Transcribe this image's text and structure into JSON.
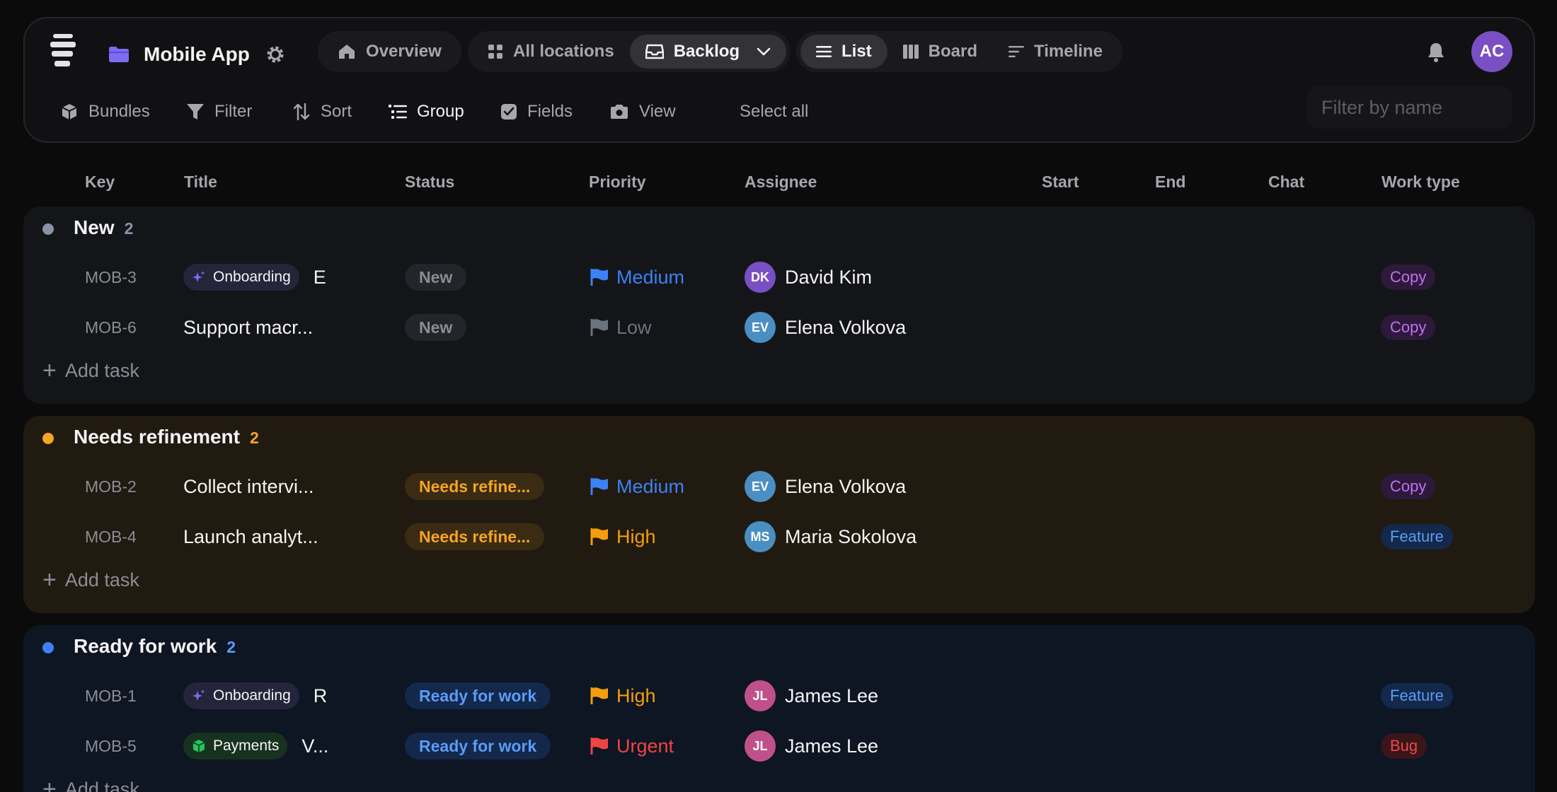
{
  "project": {
    "name": "Mobile App",
    "avatar_initials": "AC",
    "accent": "#7b4fc4"
  },
  "nav": {
    "overview": "Overview",
    "all_locations": "All locations",
    "backlog": "Backlog",
    "list": "List",
    "board": "Board",
    "timeline": "Timeline"
  },
  "toolbar": {
    "bundles": "Bundles",
    "filter": "Filter",
    "sort": "Sort",
    "group": "Group",
    "fields": "Fields",
    "view": "View",
    "select_all": "Select all",
    "filter_placeholder": "Filter by name"
  },
  "columns": {
    "key": "Key",
    "title": "Title",
    "status": "Status",
    "priority": "Priority",
    "assignee": "Assignee",
    "start": "Start",
    "end": "End",
    "chat": "Chat",
    "work_type": "Work type"
  },
  "add_task": "Add task",
  "groups": [
    {
      "name": "New",
      "count": "2",
      "color": "#8a93a6",
      "rows": [
        {
          "key": "MOB-3",
          "tag": "Onboarding",
          "title": "E",
          "status": "New",
          "priority": "Medium",
          "assignee_initials": "DK",
          "assignee": "David Kim",
          "work_type": "Copy"
        },
        {
          "key": "MOB-6",
          "tag": "",
          "title": "Support macr...",
          "status": "New",
          "priority": "Low",
          "assignee_initials": "EV",
          "assignee": "Elena Volkova",
          "work_type": "Copy"
        }
      ]
    },
    {
      "name": "Needs refinement",
      "count": "2",
      "color": "#f5a524",
      "rows": [
        {
          "key": "MOB-2",
          "tag": "",
          "title": "Collect intervi...",
          "status": "Needs refine...",
          "priority": "Medium",
          "assignee_initials": "EV",
          "assignee": "Elena Volkova",
          "work_type": "Copy"
        },
        {
          "key": "MOB-4",
          "tag": "",
          "title": "Launch analyt...",
          "status": "Needs refine...",
          "priority": "High",
          "assignee_initials": "MS",
          "assignee": "Maria Sokolova",
          "work_type": "Feature"
        }
      ]
    },
    {
      "name": "Ready for work",
      "count": "2",
      "color": "#3b82f6",
      "rows": [
        {
          "key": "MOB-1",
          "tag": "Onboarding",
          "title": "R",
          "status": "Ready for work",
          "priority": "High",
          "assignee_initials": "JL",
          "assignee": "James Lee",
          "work_type": "Feature"
        },
        {
          "key": "MOB-5",
          "tag": "Payments",
          "title": "V...",
          "status": "Ready for work",
          "priority": "Urgent",
          "assignee_initials": "JL",
          "assignee": "James Lee",
          "work_type": "Bug"
        }
      ]
    }
  ],
  "colors": {
    "priority_medium": "#3b82f6",
    "priority_low": "#6b7280",
    "priority_high": "#f59e0b",
    "priority_urgent": "#ef4444",
    "avatar_dk": "#7b4fc4",
    "avatar_ev": "#4a8fc2",
    "avatar_ms": "#4a8fc2",
    "avatar_jl": "#c0508a"
  }
}
